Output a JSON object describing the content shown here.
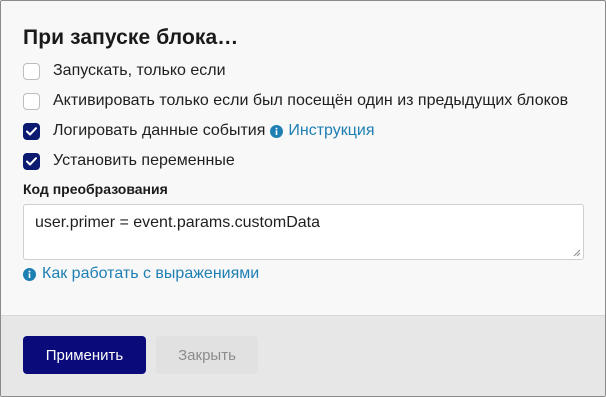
{
  "dialog": {
    "title": "При запуске блока…",
    "options": [
      {
        "label": "Запускать, только если",
        "checked": false
      },
      {
        "label": "Активировать только если был посещён один из предыдущих блоков",
        "checked": false
      },
      {
        "label": "Логировать данные события",
        "checked": true,
        "help_link": "Инструкция"
      },
      {
        "label": "Установить переменные",
        "checked": true
      }
    ],
    "code_label": "Код преобразования",
    "code_value": "user.primer = event.params.customData",
    "expressions_link": "Как работать с выражениями",
    "apply_label": "Применить",
    "close_label": "Закрыть"
  },
  "colors": {
    "checkbox_checked": "#0c1a72",
    "link": "#1e7fb3",
    "primary_button": "#0a0a7a"
  },
  "icons": [
    "check-icon",
    "info-icon"
  ]
}
